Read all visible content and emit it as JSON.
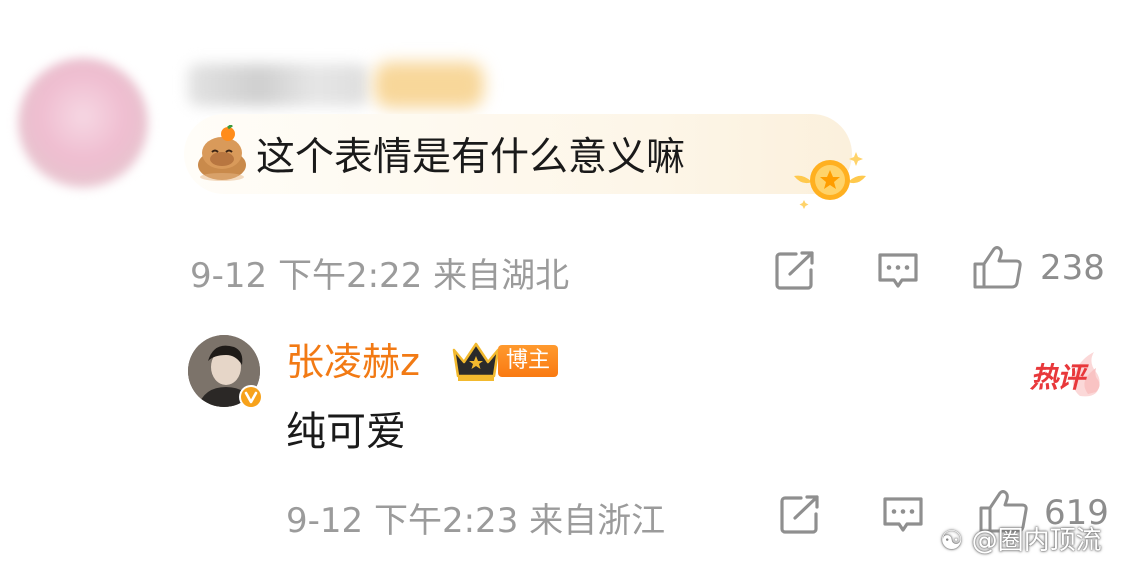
{
  "comments": [
    {
      "text": "这个表情是有什么意义嘛",
      "emoji": "capybara-with-orange-emoji",
      "time": "9-12 下午2:22",
      "location": "来自湖北",
      "likes": "238"
    }
  ],
  "reply": {
    "author": "张凌赫z",
    "badge": "博主",
    "text": "纯可爱",
    "hot_tag": "热评",
    "time": "9-12 下午2:23",
    "location": "来自浙江",
    "likes": "619"
  },
  "watermark": "@圈内顶流",
  "colors": {
    "author_orange": "#f27a14",
    "meta_gray": "#9b9b9b",
    "hot_red": "#e8383b"
  }
}
